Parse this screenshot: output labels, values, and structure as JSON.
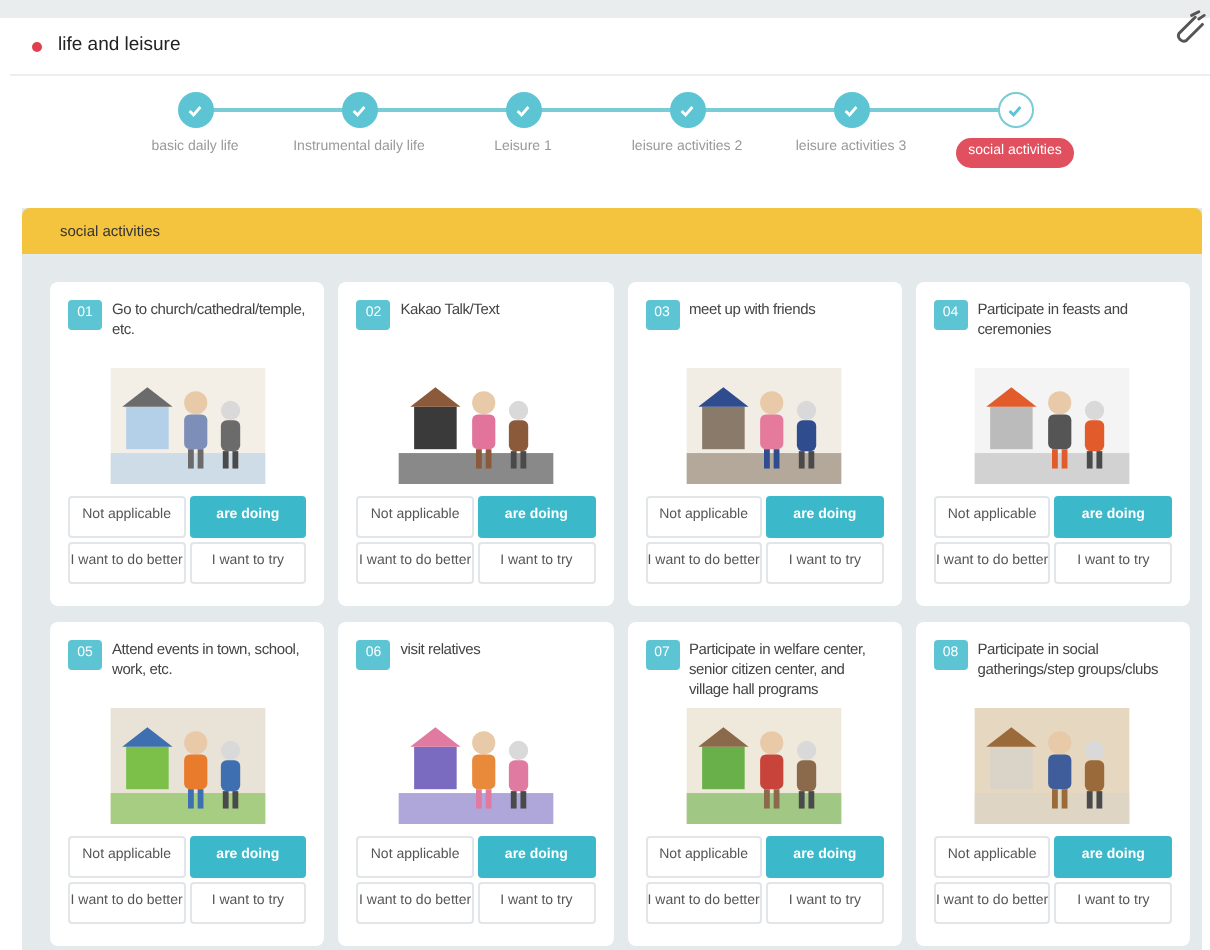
{
  "section": {
    "title": "life and leisure"
  },
  "steps": [
    {
      "label": "basic daily life",
      "done": true,
      "selected": false
    },
    {
      "label": "Instrumental daily life",
      "done": true,
      "selected": false
    },
    {
      "label": "Leisure 1",
      "done": true,
      "selected": false
    },
    {
      "label": "leisure activities 2",
      "done": true,
      "selected": false
    },
    {
      "label": "leisure activities 3",
      "done": true,
      "selected": false
    },
    {
      "label": "social activities",
      "done": false,
      "selected": true
    }
  ],
  "panel": {
    "title": "social activities"
  },
  "cards": [
    {
      "number": "01",
      "title": "Go to church/cathedral/temple, etc.",
      "options": [
        {
          "label": "Not applicable",
          "selected": false
        },
        {
          "label": "are doing",
          "selected": true
        },
        {
          "label": "I want to do better",
          "selected": false
        },
        {
          "label": "I want to try",
          "selected": false
        }
      ]
    },
    {
      "number": "02",
      "title": "Kakao Talk/Text",
      "options": [
        {
          "label": "Not applicable",
          "selected": false
        },
        {
          "label": "are doing",
          "selected": true
        },
        {
          "label": "I want to do better",
          "selected": false
        },
        {
          "label": "I want to try",
          "selected": false
        }
      ]
    },
    {
      "number": "03",
      "title": "meet up with friends",
      "options": [
        {
          "label": "Not applicable",
          "selected": false
        },
        {
          "label": "are doing",
          "selected": true
        },
        {
          "label": "I want to do better",
          "selected": false
        },
        {
          "label": "I want to try",
          "selected": false
        }
      ]
    },
    {
      "number": "04",
      "title": "Participate in feasts and ceremonies",
      "options": [
        {
          "label": "Not applicable",
          "selected": false
        },
        {
          "label": "are doing",
          "selected": true
        },
        {
          "label": "I want to do better",
          "selected": false
        },
        {
          "label": "I want to try",
          "selected": false
        }
      ]
    },
    {
      "number": "05",
      "title": "Attend events in town, school, work, etc.",
      "options": [
        {
          "label": "Not applicable",
          "selected": false
        },
        {
          "label": "are doing",
          "selected": true
        },
        {
          "label": "I want to do better",
          "selected": false
        },
        {
          "label": "I want to try",
          "selected": false
        }
      ]
    },
    {
      "number": "06",
      "title": "visit relatives",
      "options": [
        {
          "label": "Not applicable",
          "selected": false
        },
        {
          "label": "are doing",
          "selected": true
        },
        {
          "label": "I want to do better",
          "selected": false
        },
        {
          "label": "I want to try",
          "selected": false
        }
      ]
    },
    {
      "number": "07",
      "title": "Participate in welfare center, senior citizen center, and village hall programs",
      "options": [
        {
          "label": "Not applicable",
          "selected": false
        },
        {
          "label": "are doing",
          "selected": true
        },
        {
          "label": "I want to do better",
          "selected": false
        },
        {
          "label": "I want to try",
          "selected": false
        }
      ]
    },
    {
      "number": "08",
      "title": "Participate in social gatherings/step groups/clubs",
      "options": [
        {
          "label": "Not applicable",
          "selected": false
        },
        {
          "label": "are doing",
          "selected": true
        },
        {
          "label": "I want to do better",
          "selected": false
        },
        {
          "label": "I want to try",
          "selected": false
        }
      ]
    }
  ]
}
